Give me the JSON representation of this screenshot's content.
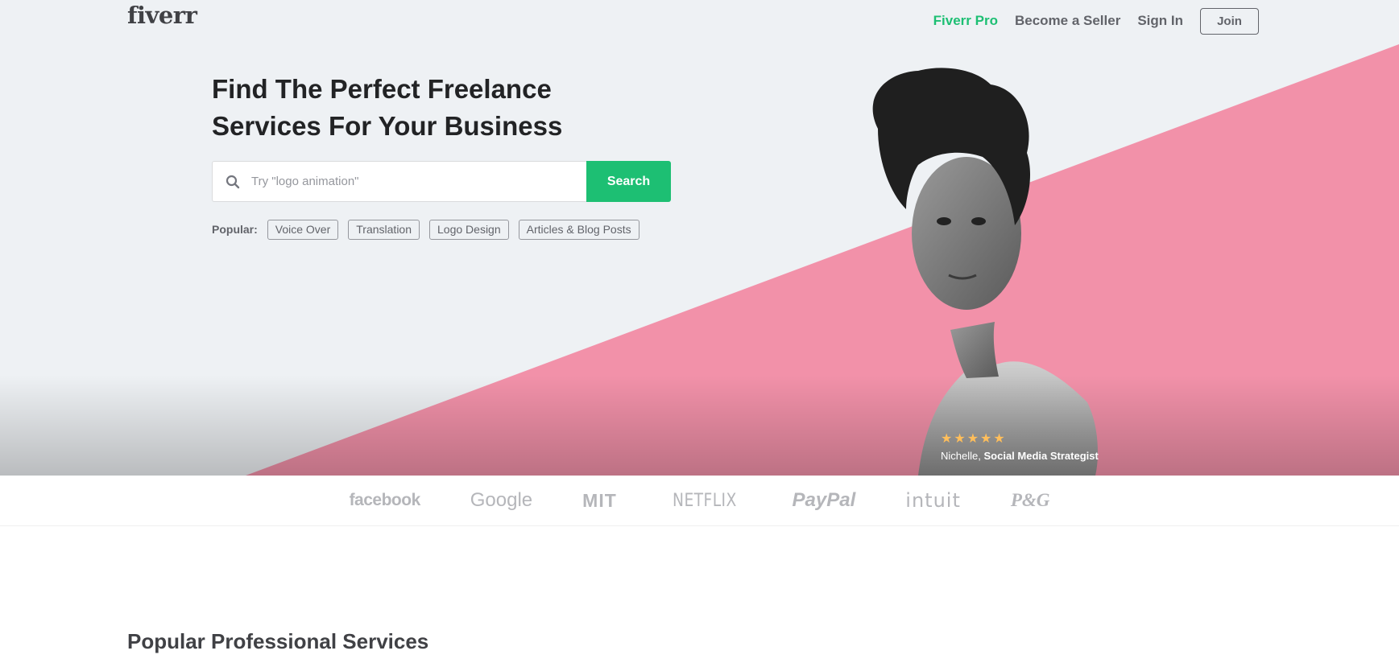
{
  "header": {
    "logo": "fiverr",
    "nav": {
      "pro": "Fiverr Pro",
      "seller": "Become a Seller",
      "signin": "Sign In",
      "join": "Join"
    }
  },
  "hero": {
    "headline_line1": "Find The Perfect Freelance",
    "headline_line2": "Services For Your Business",
    "search": {
      "placeholder": "Try \"logo animation\"",
      "button": "Search"
    },
    "popular": {
      "label": "Popular:",
      "tags": [
        "Voice Over",
        "Translation",
        "Logo Design",
        "Articles & Blog Posts"
      ]
    },
    "testimonial": {
      "rating": 5,
      "name": "Nichelle,",
      "role": "Social Media Strategist"
    }
  },
  "trusted_by": [
    "facebook",
    "Google",
    "MIT",
    "NETFLIX",
    "PayPal",
    "intuit",
    "P&G"
  ],
  "section": {
    "title": "Popular Professional Services"
  },
  "colors": {
    "accent_green": "#1dbf73",
    "hero_pink": "#f291a9",
    "hero_bg": "#eef1f4",
    "star": "#ffbe5b"
  }
}
